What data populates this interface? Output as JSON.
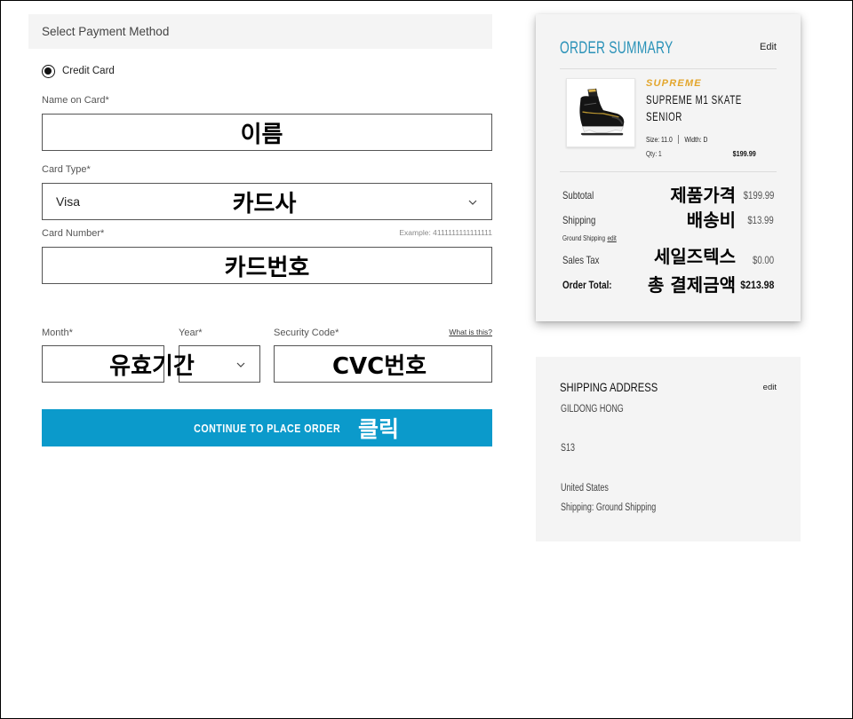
{
  "payment": {
    "section_title": "Select Payment Method",
    "method": {
      "label": "Credit Card",
      "selected": true
    },
    "name_on_card": {
      "label": "Name on Card*",
      "annotation": "이름"
    },
    "card_type": {
      "label": "Card Type*",
      "value": "Visa",
      "annotation": "카드사"
    },
    "card_number": {
      "label": "Card Number*",
      "example": "Example: 4111111111111111",
      "annotation": "카드번호"
    },
    "expiry": {
      "month_label": "Month*",
      "year_label": "Year*",
      "annotation": "유효기간"
    },
    "security_code": {
      "label": "Security Code*",
      "help_link": "What is this?",
      "annotation": "CVC번호"
    },
    "submit": {
      "label": "CONTINUE TO PLACE ORDER",
      "annotation": "클릭"
    }
  },
  "order_summary": {
    "title": "ORDER SUMMARY",
    "edit_label": "Edit",
    "item": {
      "brand": "SUPREME",
      "name": "SUPREME M1 SKATE SENIOR",
      "size": "Size: 11.0",
      "width": "Width: D",
      "qty": "Qty: 1",
      "price": "$199.99"
    },
    "subtotal": {
      "label": "Subtotal",
      "value": "$199.99",
      "annotation": "제품가격"
    },
    "shipping": {
      "label": "Shipping",
      "value": "$13.99",
      "method": "Ground Shipping",
      "edit_label": "edit",
      "annotation": "배송비"
    },
    "sales_tax": {
      "label": "Sales Tax",
      "value": "$0.00",
      "annotation": "세일즈텍스"
    },
    "order_total": {
      "label": "Order Total:",
      "value": "$213.98",
      "annotation": "총 결제금액"
    }
  },
  "shipping_address": {
    "title": "SHIPPING ADDRESS",
    "edit_label": "edit",
    "lines": [
      "GILDONG HONG",
      "S13",
      "United States",
      "Shipping: Ground Shipping"
    ]
  },
  "icons": {
    "payment_radio": "radio-checked-icon",
    "select_arrow": "chevron-down-icon",
    "product_image": "hockey-skate-image"
  },
  "colors": {
    "button_bg": "#0b9acb",
    "summary_title": "#2a92b8",
    "brand_logo": "#e3a52a",
    "panel_bg": "#f4f4f4",
    "annotation_text": "#000000"
  }
}
